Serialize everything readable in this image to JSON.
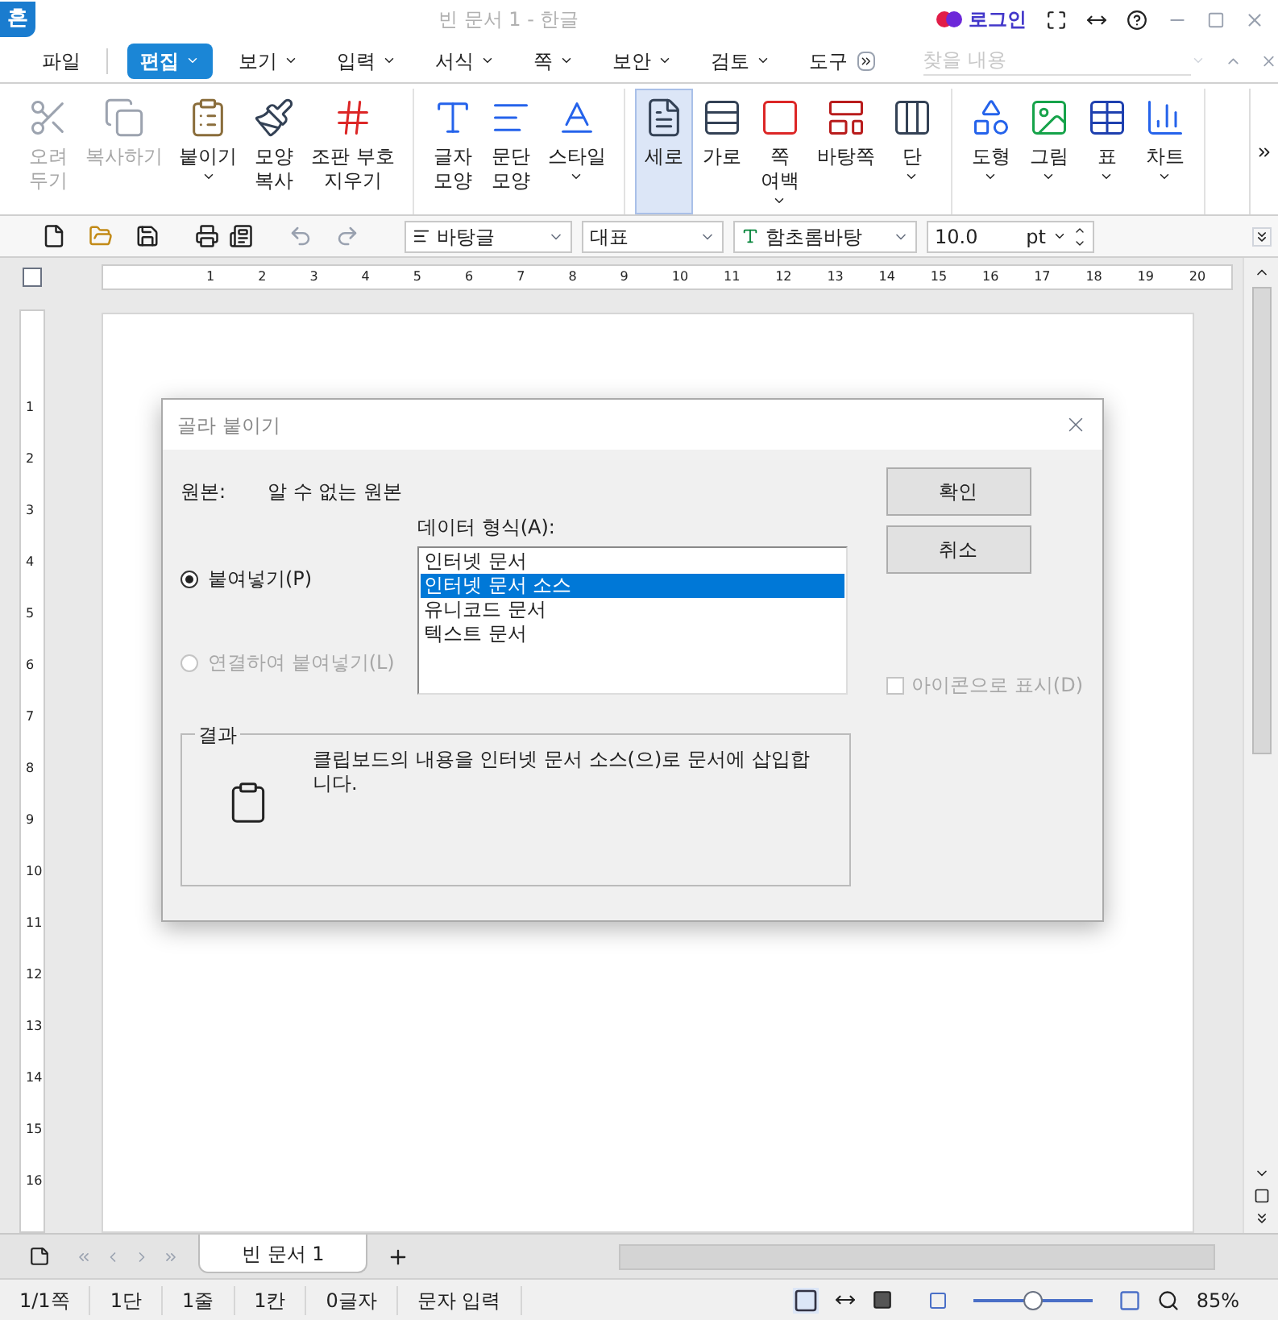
{
  "window": {
    "logo": "흔",
    "title": "빈 문서 1 - 한글",
    "login": "로그인"
  },
  "menu": [
    {
      "label": "파일",
      "selected": false,
      "dropdown": false
    },
    {
      "label": "편집",
      "selected": true,
      "dropdown": true
    },
    {
      "label": "보기",
      "selected": false,
      "dropdown": true
    },
    {
      "label": "입력",
      "selected": false,
      "dropdown": true
    },
    {
      "label": "서식",
      "selected": false,
      "dropdown": true
    },
    {
      "label": "쪽",
      "selected": false,
      "dropdown": true
    },
    {
      "label": "보안",
      "selected": false,
      "dropdown": true
    },
    {
      "label": "검토",
      "selected": false,
      "dropdown": true
    },
    {
      "label": "도구",
      "selected": false,
      "dropdown": false
    }
  ],
  "find": {
    "placeholder": "찾을 내용"
  },
  "ribbon": {
    "groups": [
      {
        "items": [
          {
            "label": "오려\n두기",
            "disabled": true,
            "selected": false,
            "dropdown": false
          },
          {
            "label": "복사하기",
            "disabled": true,
            "selected": false,
            "dropdown": false
          },
          {
            "label": "붙이기",
            "disabled": false,
            "selected": false,
            "dropdown": true
          },
          {
            "label": "모양\n복사",
            "disabled": false,
            "selected": false,
            "dropdown": false
          },
          {
            "label": "조판 부호\n지우기",
            "disabled": false,
            "selected": false,
            "dropdown": false
          }
        ]
      },
      {
        "items": [
          {
            "label": "글자\n모양",
            "disabled": false,
            "selected": false,
            "dropdown": false
          },
          {
            "label": "문단\n모양",
            "disabled": false,
            "selected": false,
            "dropdown": false
          },
          {
            "label": "스타일",
            "disabled": false,
            "selected": false,
            "dropdown": true
          }
        ]
      },
      {
        "items": [
          {
            "label": "세로",
            "disabled": false,
            "selected": true,
            "dropdown": false
          },
          {
            "label": "가로",
            "disabled": false,
            "selected": false,
            "dropdown": false
          },
          {
            "label": "쪽\n여백",
            "disabled": false,
            "selected": false,
            "dropdown": true
          },
          {
            "label": "바탕쪽",
            "disabled": false,
            "selected": false,
            "dropdown": false
          },
          {
            "label": "단",
            "disabled": false,
            "selected": false,
            "dropdown": true
          }
        ]
      },
      {
        "items": [
          {
            "label": "도형",
            "disabled": false,
            "selected": false,
            "dropdown": true
          },
          {
            "label": "그림",
            "disabled": false,
            "selected": false,
            "dropdown": true
          },
          {
            "label": "표",
            "disabled": false,
            "selected": false,
            "dropdown": true
          },
          {
            "label": "차트",
            "disabled": false,
            "selected": false,
            "dropdown": true
          }
        ]
      }
    ]
  },
  "toolbar": {
    "style": "바탕글",
    "outline": "대표",
    "font": "함초롬바탕",
    "size": "10.0",
    "unit": "pt"
  },
  "ruler": {
    "horizontal": [
      "1",
      "2",
      "3",
      "4",
      "5",
      "6",
      "7",
      "8",
      "9",
      "10",
      "11",
      "12",
      "13",
      "14",
      "15",
      "16",
      "17",
      "18",
      "19",
      "20"
    ],
    "vertical": [
      "1",
      "2",
      "3",
      "4",
      "5",
      "6",
      "7",
      "8",
      "9",
      "10",
      "11",
      "12",
      "13",
      "14",
      "15",
      "16"
    ]
  },
  "dialog": {
    "title": "골라 붙이기",
    "source_label": "원본:",
    "source_value": "알 수 없는 원본",
    "format_label": "데이터 형식(A):",
    "options": [
      {
        "label": "붙여넣기(P)",
        "selected": true,
        "disabled": false
      },
      {
        "label": "연결하여 붙여넣기(L)",
        "selected": false,
        "disabled": true
      }
    ],
    "formats": [
      {
        "label": "인터넷 문서",
        "selected": false
      },
      {
        "label": "인터넷 문서 소스",
        "selected": true
      },
      {
        "label": "유니코드 문서",
        "selected": false
      },
      {
        "label": "텍스트 문서",
        "selected": false
      }
    ],
    "buttons": [
      "확인",
      "취소"
    ],
    "display_as_icon": {
      "label": "아이콘으로 표시(D)",
      "checked": false,
      "disabled": true
    },
    "result": {
      "title": "결과",
      "text": "클립보드의 내용을 인터넷 문서 소스(으)로 문서에 삽입합니다."
    }
  },
  "tabs": [
    {
      "label": "빈 문서 1",
      "selected": true
    }
  ],
  "status_bar": {
    "items": [
      "1/1쪽",
      "1단",
      "1줄",
      "1칸",
      "0글자",
      "문자 입력"
    ],
    "zoom_slider": {
      "level": 0.5
    },
    "zoom": "85%"
  }
}
